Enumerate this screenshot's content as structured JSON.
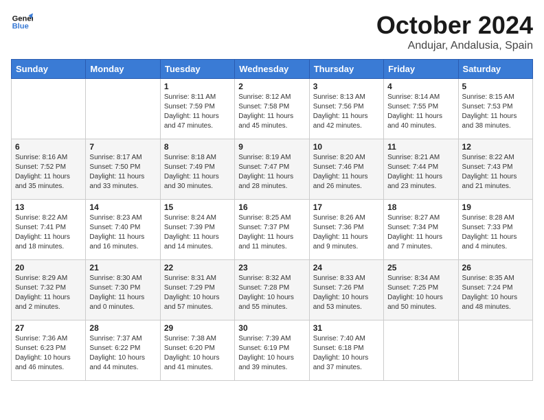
{
  "logo": {
    "line1": "General",
    "line2": "Blue"
  },
  "title": "October 2024",
  "location": "Andujar, Andalusia, Spain",
  "headers": [
    "Sunday",
    "Monday",
    "Tuesday",
    "Wednesday",
    "Thursday",
    "Friday",
    "Saturday"
  ],
  "weeks": [
    [
      {
        "day": "",
        "info": ""
      },
      {
        "day": "",
        "info": ""
      },
      {
        "day": "1",
        "info": "Sunrise: 8:11 AM\nSunset: 7:59 PM\nDaylight: 11 hours and 47 minutes."
      },
      {
        "day": "2",
        "info": "Sunrise: 8:12 AM\nSunset: 7:58 PM\nDaylight: 11 hours and 45 minutes."
      },
      {
        "day": "3",
        "info": "Sunrise: 8:13 AM\nSunset: 7:56 PM\nDaylight: 11 hours and 42 minutes."
      },
      {
        "day": "4",
        "info": "Sunrise: 8:14 AM\nSunset: 7:55 PM\nDaylight: 11 hours and 40 minutes."
      },
      {
        "day": "5",
        "info": "Sunrise: 8:15 AM\nSunset: 7:53 PM\nDaylight: 11 hours and 38 minutes."
      }
    ],
    [
      {
        "day": "6",
        "info": "Sunrise: 8:16 AM\nSunset: 7:52 PM\nDaylight: 11 hours and 35 minutes."
      },
      {
        "day": "7",
        "info": "Sunrise: 8:17 AM\nSunset: 7:50 PM\nDaylight: 11 hours and 33 minutes."
      },
      {
        "day": "8",
        "info": "Sunrise: 8:18 AM\nSunset: 7:49 PM\nDaylight: 11 hours and 30 minutes."
      },
      {
        "day": "9",
        "info": "Sunrise: 8:19 AM\nSunset: 7:47 PM\nDaylight: 11 hours and 28 minutes."
      },
      {
        "day": "10",
        "info": "Sunrise: 8:20 AM\nSunset: 7:46 PM\nDaylight: 11 hours and 26 minutes."
      },
      {
        "day": "11",
        "info": "Sunrise: 8:21 AM\nSunset: 7:44 PM\nDaylight: 11 hours and 23 minutes."
      },
      {
        "day": "12",
        "info": "Sunrise: 8:22 AM\nSunset: 7:43 PM\nDaylight: 11 hours and 21 minutes."
      }
    ],
    [
      {
        "day": "13",
        "info": "Sunrise: 8:22 AM\nSunset: 7:41 PM\nDaylight: 11 hours and 18 minutes."
      },
      {
        "day": "14",
        "info": "Sunrise: 8:23 AM\nSunset: 7:40 PM\nDaylight: 11 hours and 16 minutes."
      },
      {
        "day": "15",
        "info": "Sunrise: 8:24 AM\nSunset: 7:39 PM\nDaylight: 11 hours and 14 minutes."
      },
      {
        "day": "16",
        "info": "Sunrise: 8:25 AM\nSunset: 7:37 PM\nDaylight: 11 hours and 11 minutes."
      },
      {
        "day": "17",
        "info": "Sunrise: 8:26 AM\nSunset: 7:36 PM\nDaylight: 11 hours and 9 minutes."
      },
      {
        "day": "18",
        "info": "Sunrise: 8:27 AM\nSunset: 7:34 PM\nDaylight: 11 hours and 7 minutes."
      },
      {
        "day": "19",
        "info": "Sunrise: 8:28 AM\nSunset: 7:33 PM\nDaylight: 11 hours and 4 minutes."
      }
    ],
    [
      {
        "day": "20",
        "info": "Sunrise: 8:29 AM\nSunset: 7:32 PM\nDaylight: 11 hours and 2 minutes."
      },
      {
        "day": "21",
        "info": "Sunrise: 8:30 AM\nSunset: 7:30 PM\nDaylight: 11 hours and 0 minutes."
      },
      {
        "day": "22",
        "info": "Sunrise: 8:31 AM\nSunset: 7:29 PM\nDaylight: 10 hours and 57 minutes."
      },
      {
        "day": "23",
        "info": "Sunrise: 8:32 AM\nSunset: 7:28 PM\nDaylight: 10 hours and 55 minutes."
      },
      {
        "day": "24",
        "info": "Sunrise: 8:33 AM\nSunset: 7:26 PM\nDaylight: 10 hours and 53 minutes."
      },
      {
        "day": "25",
        "info": "Sunrise: 8:34 AM\nSunset: 7:25 PM\nDaylight: 10 hours and 50 minutes."
      },
      {
        "day": "26",
        "info": "Sunrise: 8:35 AM\nSunset: 7:24 PM\nDaylight: 10 hours and 48 minutes."
      }
    ],
    [
      {
        "day": "27",
        "info": "Sunrise: 7:36 AM\nSunset: 6:23 PM\nDaylight: 10 hours and 46 minutes."
      },
      {
        "day": "28",
        "info": "Sunrise: 7:37 AM\nSunset: 6:22 PM\nDaylight: 10 hours and 44 minutes."
      },
      {
        "day": "29",
        "info": "Sunrise: 7:38 AM\nSunset: 6:20 PM\nDaylight: 10 hours and 41 minutes."
      },
      {
        "day": "30",
        "info": "Sunrise: 7:39 AM\nSunset: 6:19 PM\nDaylight: 10 hours and 39 minutes."
      },
      {
        "day": "31",
        "info": "Sunrise: 7:40 AM\nSunset: 6:18 PM\nDaylight: 10 hours and 37 minutes."
      },
      {
        "day": "",
        "info": ""
      },
      {
        "day": "",
        "info": ""
      }
    ]
  ]
}
